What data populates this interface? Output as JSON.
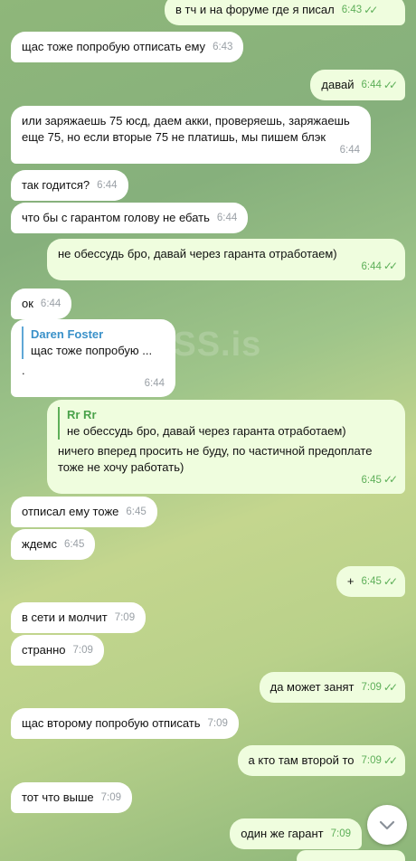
{
  "watermark": "XSS.is",
  "messages": [
    {
      "text": "в тч и на форуме где я писал",
      "time": "6:43"
    },
    {
      "text": "щас тоже попробую отписать ему",
      "time": "6:43"
    },
    {
      "text": "давай",
      "time": "6:44"
    },
    {
      "text": "или заряжаешь 75 юсд, даем акки, проверяешь, заряжаешь еще 75, но если вторые 75 не платишь, мы пишем блэк",
      "time": "6:44"
    },
    {
      "text": "так годится?",
      "time": "6:44"
    },
    {
      "text": "что бы с гарантом голову не ебать",
      "time": "6:44"
    },
    {
      "text": "не обессудь бро, давай через гаранта отработаем)",
      "time": "6:44"
    },
    {
      "text": "ок",
      "time": "6:44"
    },
    {
      "reply_name": "Daren Foster",
      "reply_text": "щас тоже попробую ...",
      "text": ".",
      "time": "6:44"
    },
    {
      "reply_name": "Rr Rr",
      "reply_text": "не обессудь бро, давай через гаранта отработаем)",
      "text": "ничего вперед просить не буду, по частичной предоплате тоже не хочу работать)",
      "time": "6:45"
    },
    {
      "text": "отписал ему тоже",
      "time": "6:45"
    },
    {
      "text": "ждемс",
      "time": "6:45"
    },
    {
      "text": "+",
      "time": "6:45"
    },
    {
      "text": "в сети и молчит",
      "time": "7:09"
    },
    {
      "text": "странно",
      "time": "7:09"
    },
    {
      "text": "да может занят",
      "time": "7:09"
    },
    {
      "text": "щас второму попробую отписать",
      "time": "7:09"
    },
    {
      "text": "а кто там второй то",
      "time": "7:09"
    },
    {
      "text": "тот что выше",
      "time": "7:09"
    },
    {
      "text": "один же гарант",
      "time": "7:09"
    }
  ],
  "read_mark": "✓✓",
  "scroll_down_icon": "chevron-down-icon"
}
